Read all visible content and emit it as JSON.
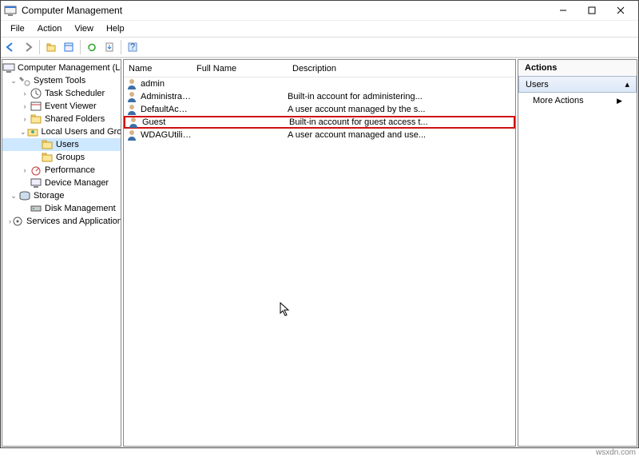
{
  "window": {
    "title": "Computer Management"
  },
  "menu": [
    "File",
    "Action",
    "View",
    "Help"
  ],
  "tree": {
    "root": "Computer Management (Local",
    "system_tools": "System Tools",
    "task_scheduler": "Task Scheduler",
    "event_viewer": "Event Viewer",
    "shared_folders": "Shared Folders",
    "local_users_groups": "Local Users and Groups",
    "users": "Users",
    "groups": "Groups",
    "performance": "Performance",
    "device_manager": "Device Manager",
    "storage": "Storage",
    "disk_management": "Disk Management",
    "services_apps": "Services and Applications"
  },
  "list": {
    "columns": {
      "name": "Name",
      "full_name": "Full Name",
      "description": "Description"
    },
    "rows": [
      {
        "name": "admin",
        "full": "",
        "desc": ""
      },
      {
        "name": "Administrator",
        "full": "",
        "desc": "Built-in account for administering..."
      },
      {
        "name": "DefaultAcco...",
        "full": "",
        "desc": "A user account managed by the s..."
      },
      {
        "name": "Guest",
        "full": "",
        "desc": "Built-in account for guest access t..."
      },
      {
        "name": "WDAGUtility...",
        "full": "",
        "desc": "A user account managed and use..."
      }
    ]
  },
  "actions": {
    "header": "Actions",
    "section": "Users",
    "more": "More Actions"
  },
  "footer": "wsxdn.com"
}
